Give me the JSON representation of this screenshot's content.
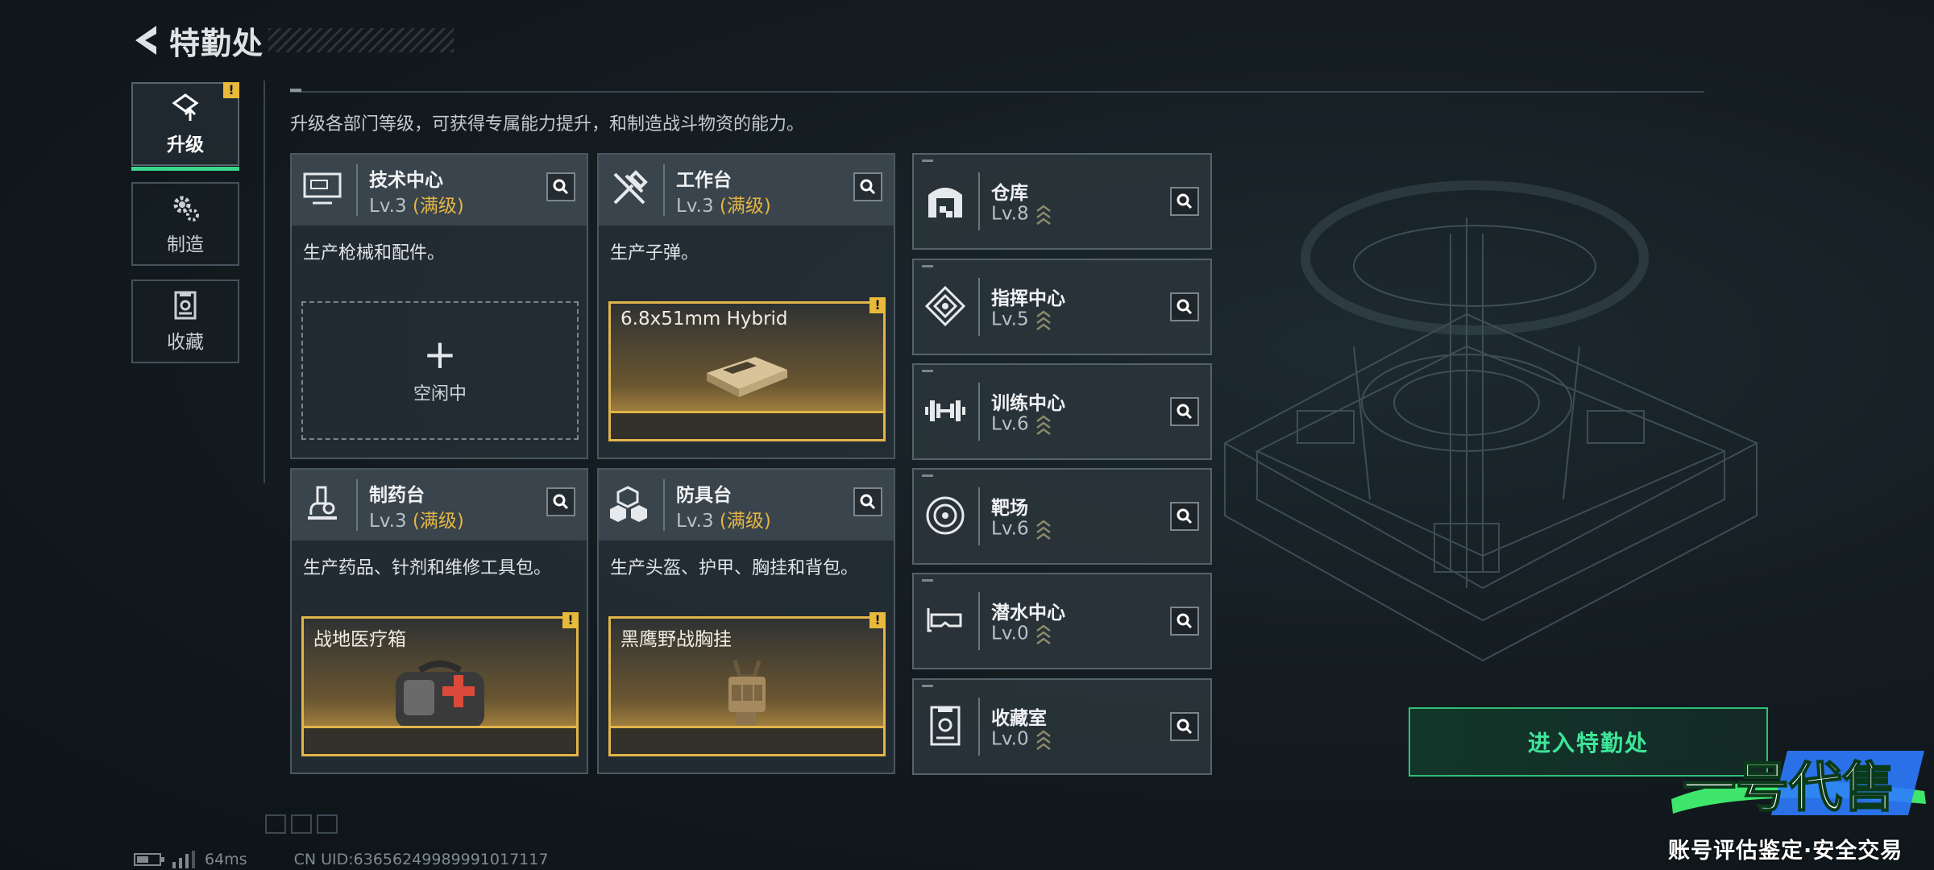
{
  "header": {
    "title": "特勤处"
  },
  "tabs": [
    {
      "label": "升级",
      "icon": "upgrade-icon",
      "active": true,
      "warning": "!"
    },
    {
      "label": "制造",
      "icon": "gear-icon",
      "active": false
    },
    {
      "label": "收藏",
      "icon": "collection-icon",
      "active": false
    }
  ],
  "description": "升级各部门等级，可获得专属能力提升，和制造战斗物资的能力。",
  "facilities": [
    {
      "name": "技术中心",
      "level": "Lv.3",
      "max": "(满级)",
      "desc": "生产枪械和配件。",
      "slot_plus": "+",
      "slot_idle": "空闲中"
    },
    {
      "name": "工作台",
      "level": "Lv.3",
      "max": "(满级)",
      "desc": "生产子弹。",
      "item": "6.8x51mm Hybrid",
      "warning": "!"
    },
    {
      "name": "制药台",
      "level": "Lv.3",
      "max": "(满级)",
      "desc": "生产药品、针剂和维修工具包。",
      "item": "战地医疗箱",
      "warning": "!"
    },
    {
      "name": "防具台",
      "level": "Lv.3",
      "max": "(满级)",
      "desc": "生产头盔、护甲、胸挂和背包。",
      "item": "黑鹰野战胸挂",
      "warning": "!"
    }
  ],
  "departments": [
    {
      "name": "仓库",
      "level": "Lv.8",
      "icon": "warehouse-icon"
    },
    {
      "name": "指挥中心",
      "level": "Lv.5",
      "icon": "command-center-icon"
    },
    {
      "name": "训练中心",
      "level": "Lv.6",
      "icon": "dumbbell-icon"
    },
    {
      "name": "靶场",
      "level": "Lv.6",
      "icon": "target-icon"
    },
    {
      "name": "潜水中心",
      "level": "Lv.0",
      "icon": "diving-mask-icon"
    },
    {
      "name": "收藏室",
      "level": "Lv.0",
      "icon": "collection-room-icon"
    }
  ],
  "enter_button": "进入特勤处",
  "footer": {
    "ping": "64ms",
    "uid": "CN UID:63656249989991017117"
  },
  "watermark": {
    "logo": "一号代售",
    "tagline": "账号评估鉴定·安全交易"
  },
  "colors": {
    "accent_green": "#39d68c",
    "max_gold": "#e4b544",
    "warning_yellow": "#e8b93a"
  }
}
